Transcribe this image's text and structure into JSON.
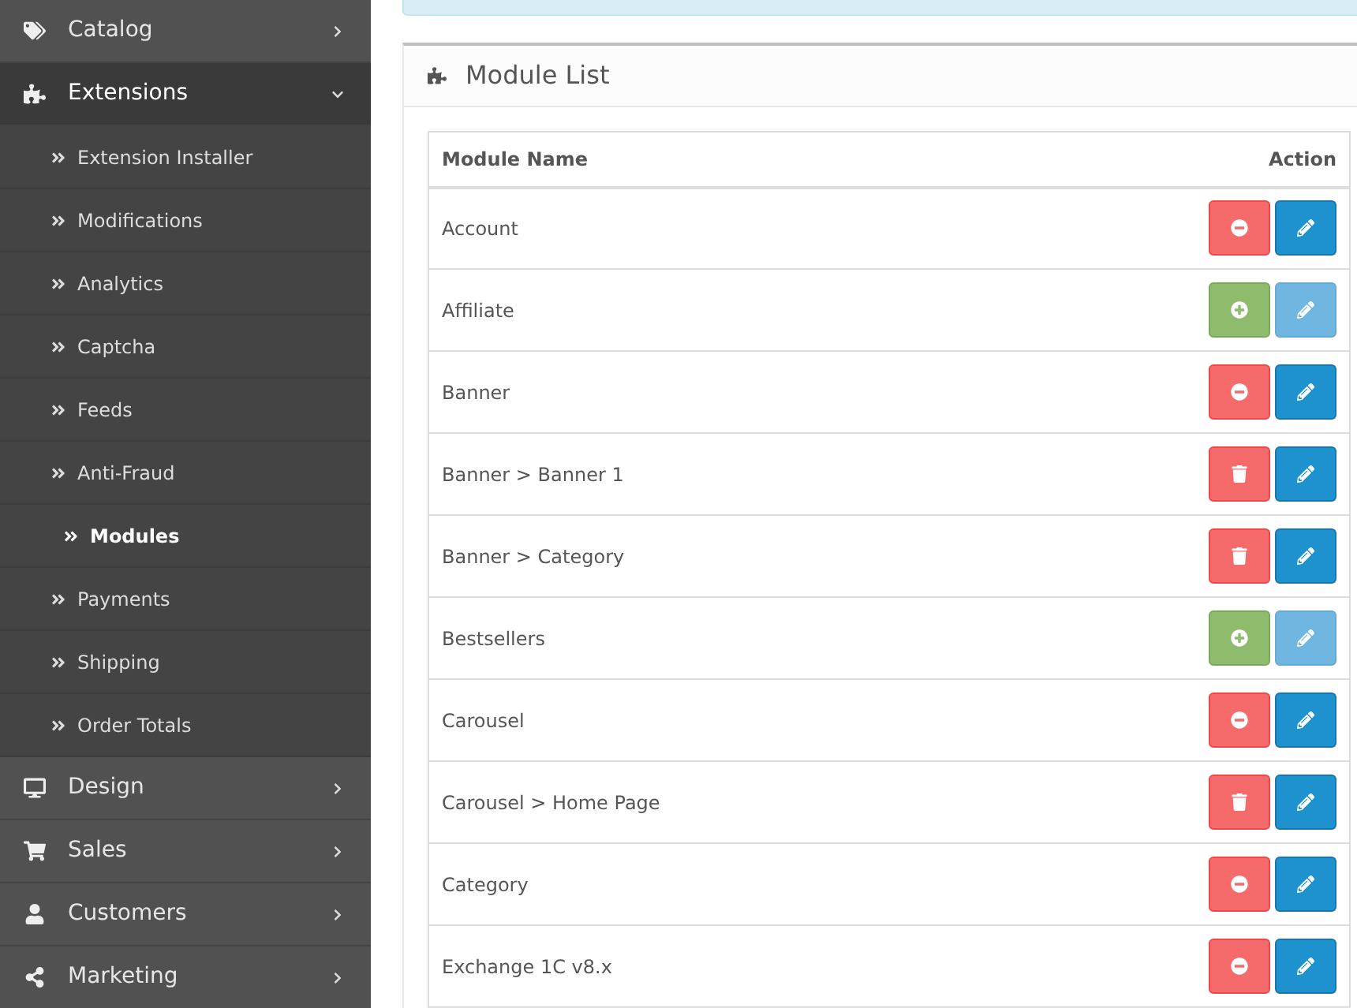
{
  "sidebar": {
    "items": [
      {
        "label": "Catalog",
        "expanded": false
      },
      {
        "label": "Extensions",
        "expanded": true,
        "children": [
          {
            "label": "Extension Installer",
            "selected": false
          },
          {
            "label": "Modifications",
            "selected": false
          },
          {
            "label": "Analytics",
            "selected": false
          },
          {
            "label": "Captcha",
            "selected": false
          },
          {
            "label": "Feeds",
            "selected": false
          },
          {
            "label": "Anti-Fraud",
            "selected": false
          },
          {
            "label": "Modules",
            "selected": true
          },
          {
            "label": "Payments",
            "selected": false
          },
          {
            "label": "Shipping",
            "selected": false
          },
          {
            "label": "Order Totals",
            "selected": false
          }
        ]
      },
      {
        "label": "Design",
        "expanded": false
      },
      {
        "label": "Sales",
        "expanded": false
      },
      {
        "label": "Customers",
        "expanded": false
      },
      {
        "label": "Marketing",
        "expanded": false
      }
    ]
  },
  "panel": {
    "title": "Module List"
  },
  "table": {
    "columns": [
      "Module Name",
      "Action"
    ],
    "rows": [
      {
        "name": "Account",
        "kind": "installed"
      },
      {
        "name": "Affiliate",
        "kind": "available"
      },
      {
        "name": "Banner",
        "kind": "installed"
      },
      {
        "name": "Banner > Banner 1",
        "kind": "instance"
      },
      {
        "name": "Banner > Category",
        "kind": "instance"
      },
      {
        "name": "Bestsellers",
        "kind": "available"
      },
      {
        "name": "Carousel",
        "kind": "installed"
      },
      {
        "name": "Carousel > Home Page",
        "kind": "instance"
      },
      {
        "name": "Category",
        "kind": "installed"
      },
      {
        "name": "Exchange 1C v8.x",
        "kind": "installed"
      }
    ]
  }
}
